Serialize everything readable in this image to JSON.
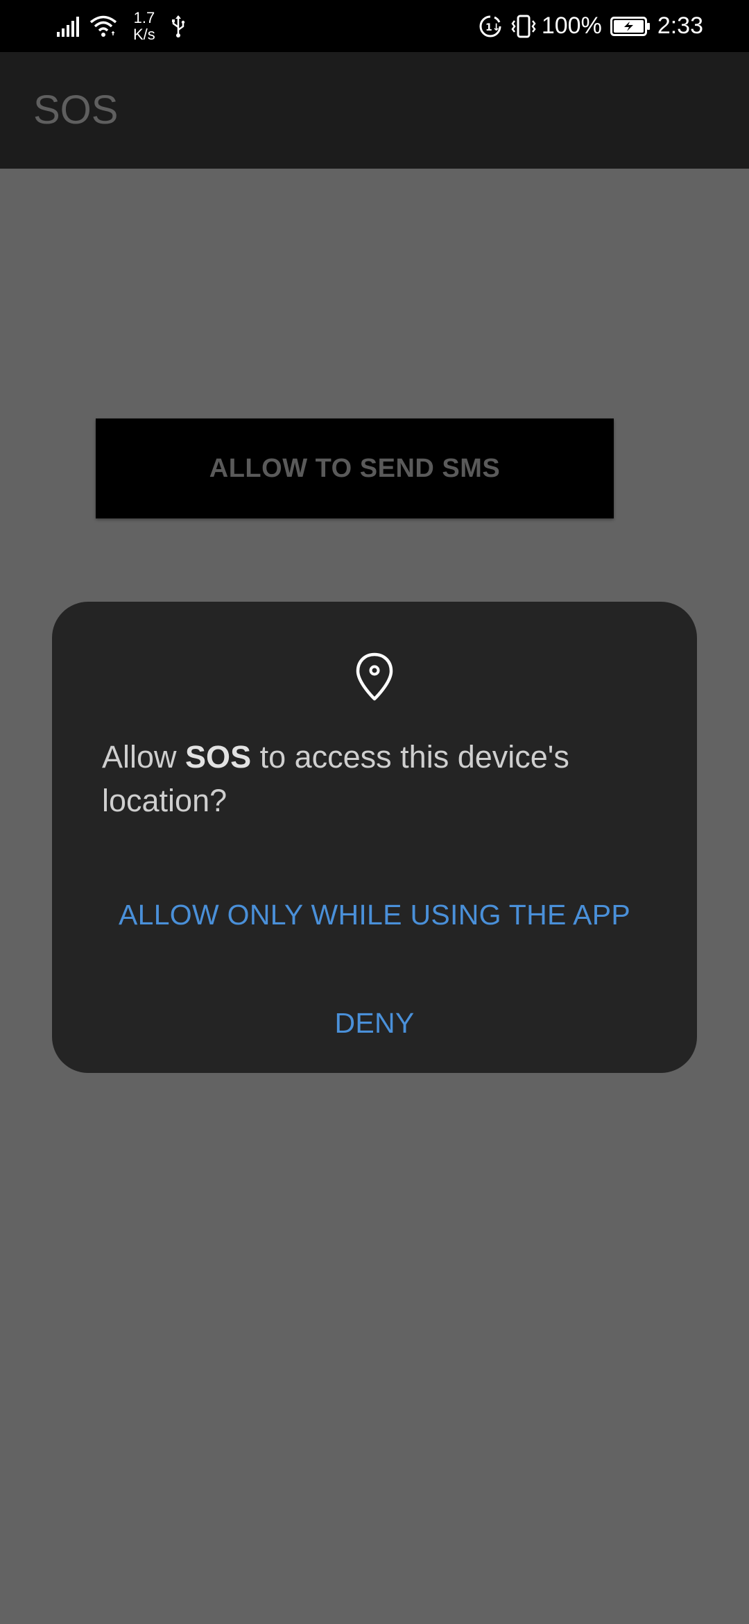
{
  "status_bar": {
    "signal_icon": "cell-signal-icon",
    "wifi_icon": "wifi-icon",
    "net_speed_value": "1.7",
    "net_speed_unit": "K/s",
    "usb_icon": "usb-icon",
    "data_saver_icon": "data-saver-icon",
    "vibrate_icon": "vibrate-icon",
    "battery_percent": "100%",
    "battery_icon": "battery-charging-icon",
    "time": "2:33"
  },
  "app_bar": {
    "title": "SOS"
  },
  "content": {
    "sms_button_label": "ALLOW TO SEND SMS"
  },
  "dialog": {
    "icon": "location-pin-icon",
    "message_prefix": "Allow ",
    "app_name": "SOS",
    "message_suffix": " to access this device's location?",
    "allow_label": "ALLOW ONLY WHILE USING THE APP",
    "deny_label": "DENY"
  },
  "colors": {
    "status_bar_bg": "#000000",
    "app_bar_bg": "#1c1c1c",
    "scrim_bg": "#636363",
    "dialog_bg": "#242424",
    "action_blue": "#4a90d9"
  }
}
